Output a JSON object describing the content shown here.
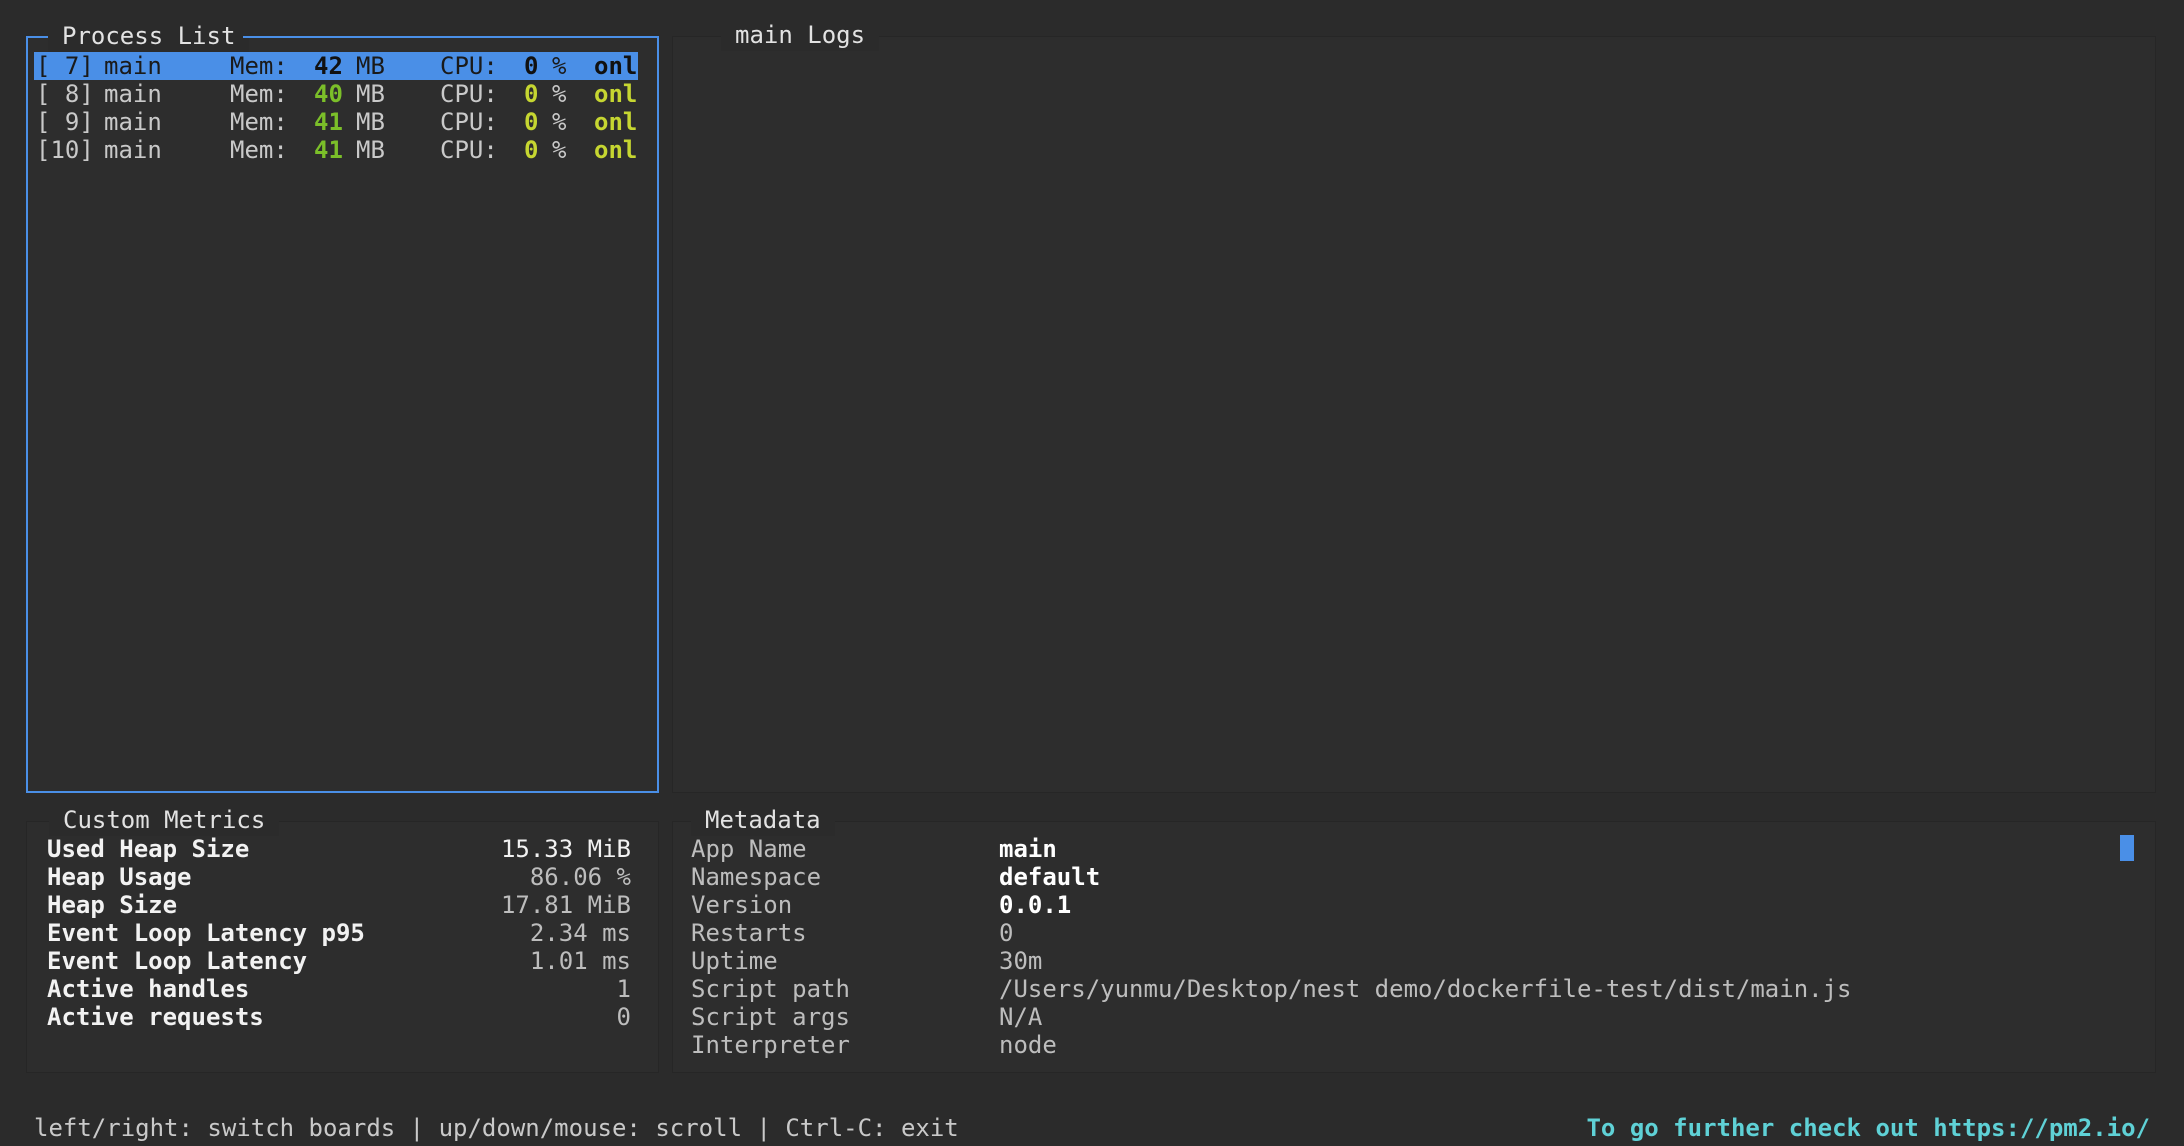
{
  "process_list": {
    "title": "Process List",
    "rows": [
      {
        "id": "[ 7]",
        "name": "main",
        "mem_label": "Mem:",
        "mem_value": "42",
        "mem_unit": "MB",
        "cpu_label": "CPU:",
        "cpu_value": "0",
        "cpu_unit": "%",
        "status": "onl",
        "selected": true
      },
      {
        "id": "[ 8]",
        "name": "main",
        "mem_label": "Mem:",
        "mem_value": "40",
        "mem_unit": "MB",
        "cpu_label": "CPU:",
        "cpu_value": "0",
        "cpu_unit": "%",
        "status": "onl",
        "selected": false
      },
      {
        "id": "[ 9]",
        "name": "main",
        "mem_label": "Mem:",
        "mem_value": "41",
        "mem_unit": "MB",
        "cpu_label": "CPU:",
        "cpu_value": "0",
        "cpu_unit": "%",
        "status": "onl",
        "selected": false
      },
      {
        "id": "[10]",
        "name": "main",
        "mem_label": "Mem:",
        "mem_value": "41",
        "mem_unit": "MB",
        "cpu_label": "CPU:",
        "cpu_value": "0",
        "cpu_unit": "%",
        "status": "onl",
        "selected": false
      }
    ]
  },
  "logs": {
    "title": "main Logs"
  },
  "custom_metrics": {
    "title": "Custom Metrics",
    "rows": [
      {
        "label": "Used Heap Size",
        "value": "15.33 MiB"
      },
      {
        "label": "Heap Usage",
        "value": "86.06 %"
      },
      {
        "label": "Heap Size",
        "value": "17.81 MiB"
      },
      {
        "label": "Event Loop Latency p95",
        "value": "2.34 ms"
      },
      {
        "label": "Event Loop Latency",
        "value": "1.01 ms"
      },
      {
        "label": "Active handles",
        "value": "1"
      },
      {
        "label": "Active requests",
        "value": "0"
      }
    ]
  },
  "metadata": {
    "title": "Metadata",
    "rows": [
      {
        "label": "App Name",
        "value": "main",
        "strong": true
      },
      {
        "label": "Namespace",
        "value": "default",
        "strong": true
      },
      {
        "label": "Version",
        "value": "0.0.1",
        "strong": true
      },
      {
        "label": "Restarts",
        "value": "0",
        "strong": false
      },
      {
        "label": "Uptime",
        "value": "30m",
        "strong": false
      },
      {
        "label": "Script path",
        "value": "/Users/yunmu/Desktop/nest demo/dockerfile-test/dist/main.js",
        "strong": false
      },
      {
        "label": "Script args",
        "value": "N/A",
        "strong": false
      },
      {
        "label": "Interpreter",
        "value": "node",
        "strong": false
      }
    ]
  },
  "footer": {
    "help": "left/right: switch boards | up/down/mouse: scroll | Ctrl-C: exit",
    "promo": "To go further check out https://pm2.io/"
  },
  "colors": {
    "background": "#2b2b2b",
    "accent": "#4a8fe7",
    "mem_green": "#7bbf29",
    "cpu_yellow": "#c6d631",
    "link_cyan": "#5fd1d6"
  }
}
